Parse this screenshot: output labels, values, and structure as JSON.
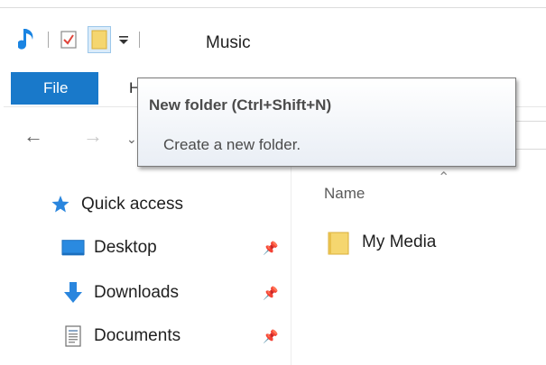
{
  "window": {
    "title": "Music",
    "qat": {
      "app_icon": "music-note-icon",
      "properties_icon": "checklist-icon",
      "new_folder_icon": "folder-icon",
      "customize_icon": "dropdown-arrow-icon"
    }
  },
  "ribbon": {
    "file_label": "File",
    "home_label": "H"
  },
  "tooltip": {
    "title": "New folder (Ctrl+Shift+N)",
    "description": "Create a new folder."
  },
  "nav": {
    "items": [
      {
        "label": "Quick access",
        "icon": "star-icon"
      },
      {
        "label": "Desktop",
        "icon": "desktop-icon"
      },
      {
        "label": "Downloads",
        "icon": "download-arrow-icon"
      },
      {
        "label": "Documents",
        "icon": "document-icon"
      }
    ]
  },
  "content": {
    "column_name": "Name",
    "files": [
      {
        "name": "My Media",
        "icon": "folder-icon"
      }
    ]
  },
  "colors": {
    "accent": "#1979ca",
    "folder": "#f5d66f",
    "tooltip_border": "#7a7a7a"
  }
}
